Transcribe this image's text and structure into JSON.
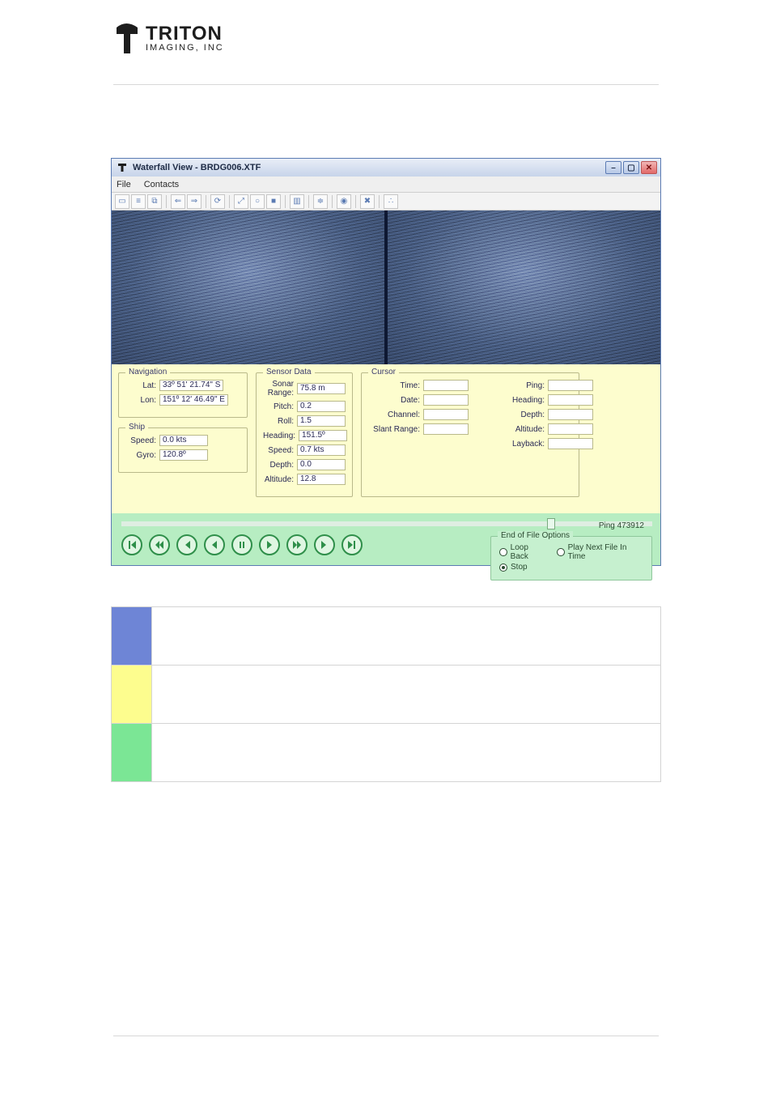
{
  "doc": {
    "logo_line1": "TRITON",
    "logo_line2": "IMAGING, INC"
  },
  "app": {
    "title": "Waterfall View - BRDG006.XTF",
    "menu": {
      "file": "File",
      "contacts": "Contacts"
    },
    "toolbar_icons": [
      "select-icon",
      "list-icon",
      "copy-icon",
      "back-icon",
      "forward-icon",
      "power-icon",
      "zoomin-icon",
      "circle-icon",
      "stop-icon",
      "column-icon",
      "layers-icon",
      "target-icon",
      "close-icon",
      "nodes-icon"
    ]
  },
  "navigation": {
    "title": "Navigation",
    "lat_label": "Lat:",
    "lat_value": "33º 51' 21.74\" S",
    "lon_label": "Lon:",
    "lon_value": "151º 12' 46.49\" E"
  },
  "ship": {
    "title": "Ship",
    "speed_label": "Speed:",
    "speed_value": "0.0 kts",
    "gyro_label": "Gyro:",
    "gyro_value": "120.8º"
  },
  "sensor": {
    "title": "Sensor Data",
    "range_label": "Sonar Range:",
    "range_value": "75.8 m",
    "pitch_label": "Pitch:",
    "pitch_value": "0.2",
    "roll_label": "Roll:",
    "roll_value": "1.5",
    "heading_label": "Heading:",
    "heading_value": "151.5º",
    "speed_label": "Speed:",
    "speed_value": "0.7 kts",
    "depth_label": "Depth:",
    "depth_value": "0.0",
    "altitude_label": "Altitude:",
    "altitude_value": "12.8"
  },
  "cursor": {
    "title": "Cursor",
    "left": {
      "time_label": "Time:",
      "date_label": "Date:",
      "channel_label": "Channel:",
      "slant_label": "Slant Range:"
    },
    "right": {
      "ping_label": "Ping:",
      "heading_label": "Heading:",
      "depth_label": "Depth:",
      "altitude_label": "Altitude:",
      "layback_label": "Layback:"
    }
  },
  "playback": {
    "seek_label": "Ping 473912",
    "buttons": [
      "skip-start",
      "step-back",
      "rewind",
      "frame-back",
      "pause",
      "play",
      "fast-forward",
      "step-forward",
      "skip-end"
    ],
    "eof_title": "End of File Options",
    "eof_loop": "Loop Back",
    "eof_next": "Play Next File In Time",
    "eof_stop": "Stop"
  },
  "legend": {
    "rows": [
      {
        "color": "blue",
        "text": ""
      },
      {
        "color": "yellow",
        "text": ""
      },
      {
        "color": "green",
        "text": ""
      }
    ]
  }
}
